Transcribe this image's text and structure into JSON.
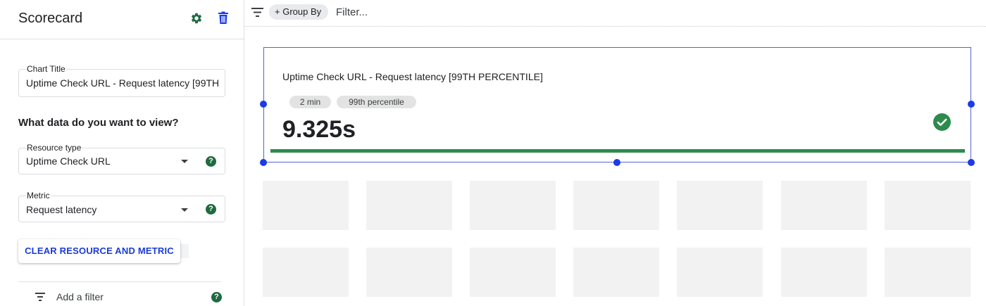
{
  "panel": {
    "title": "Scorecard",
    "settings_icon": "gear-icon",
    "delete_icon": "trash-icon"
  },
  "form": {
    "chart_title": {
      "label": "Chart Title",
      "value": "Uptime Check URL - Request latency [99TH PERCENTILE]"
    },
    "section_heading": "What data do you want to view?",
    "resource_type": {
      "label": "Resource type",
      "value": "Uptime Check URL",
      "help": "?"
    },
    "metric": {
      "label": "Metric",
      "value": "Request latency",
      "help": "?"
    },
    "clear_button": "CLEAR RESOURCE AND METRIC",
    "add_filter": {
      "label": "Add a filter",
      "help": "?"
    }
  },
  "toolbar": {
    "group_by": "+ Group By",
    "filter_placeholder": "Filter..."
  },
  "scorecard": {
    "title": "Uptime Check URL - Request latency [99TH PERCENTILE]",
    "chips": [
      "2 min",
      "99th percentile"
    ],
    "value": "9.325s",
    "status_icon": "check-circle-icon"
  },
  "colors": {
    "accent_blue": "#1a3be8",
    "success_green": "#2e8b4e",
    "help_green": "#1e6b3f",
    "button_text": "#1a3bd6"
  }
}
